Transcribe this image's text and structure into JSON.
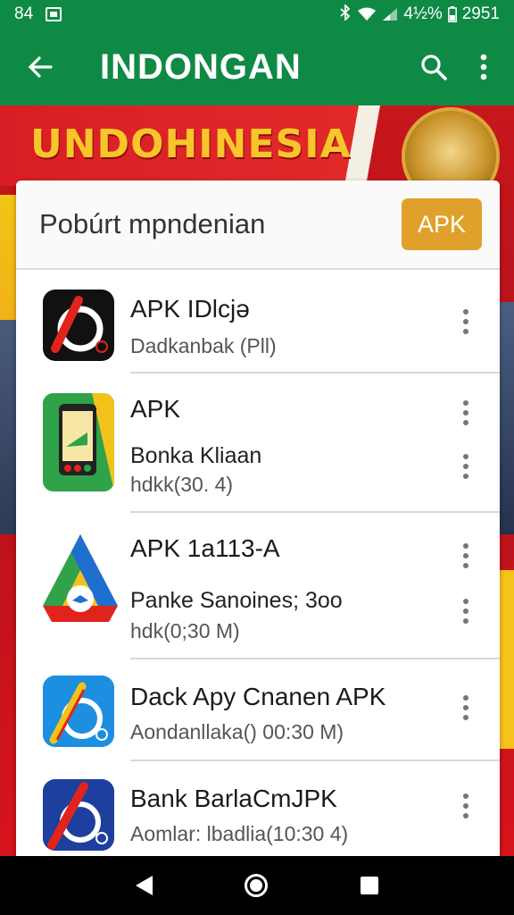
{
  "status_bar": {
    "left_number": "84",
    "battery_percent": "4½%",
    "time": "2951",
    "icons": [
      "notification-icon",
      "bluetooth-icon",
      "wifi-icon",
      "signal-icon",
      "battery-icon"
    ]
  },
  "app_bar": {
    "title": "INDONGAN",
    "icons": [
      "back-arrow-icon",
      "search-icon",
      "more-vert-icon"
    ],
    "color": "#0f8a45"
  },
  "banner": {
    "title": "UNDOHINESIA",
    "title_color": "#f7c62b",
    "background_color": "#c8161d"
  },
  "card": {
    "title": "Pobúrt mpndenian",
    "chip_label": "APK",
    "chip_color": "#e0a12c"
  },
  "items": [
    {
      "name": "APK IDlcjə",
      "lines": [
        "Dadkanbak (Pll)"
      ],
      "icon": "app-logo-red-icon"
    },
    {
      "name": "APK",
      "lines": [
        "Bonka Kliaan",
        "hdkk(30. 4)"
      ],
      "icon": "phone-app-icon"
    },
    {
      "name": "APK 1a113-A",
      "lines": [
        "Panke Sanoines; 3oo",
        "hdk(0;30 M)"
      ],
      "icon": "drive-app-icon"
    },
    {
      "name": "Dack Apy Cnanen APK",
      "lines": [
        "Aondanllaka() 00:30 M)"
      ],
      "icon": "blue-app-icon"
    },
    {
      "name": "Bank BarlaCmJPK",
      "lines": [
        "Aomlar: lbadlia(10:30 4)"
      ],
      "icon": "bank-app-icon"
    }
  ],
  "nav_bar": {
    "icons": [
      "nav-back-icon",
      "nav-home-icon",
      "nav-recents-icon"
    ]
  }
}
